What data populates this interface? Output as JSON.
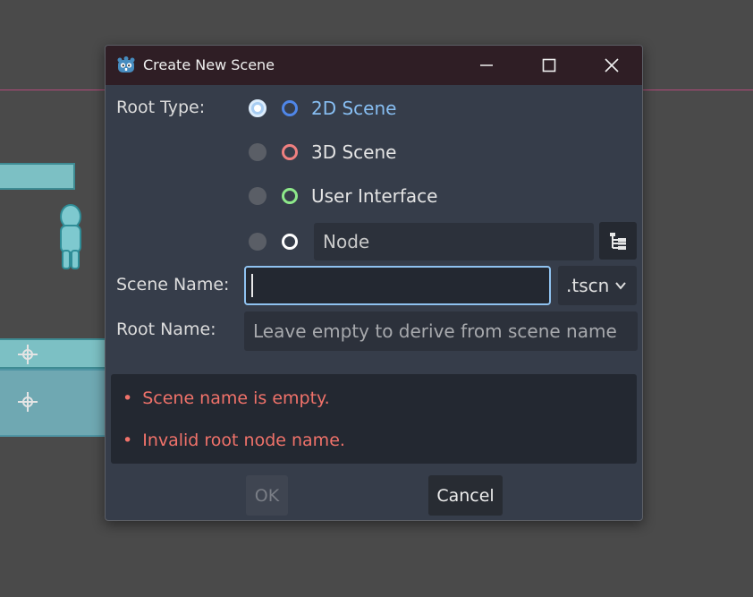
{
  "dialog": {
    "title": "Create New Scene",
    "icon": "godot-logo-icon",
    "window_controls": [
      "minimize-icon",
      "maximize-icon",
      "close-icon"
    ]
  },
  "root_type": {
    "label": "Root Type:",
    "options": [
      {
        "label": "2D Scene",
        "selected": true,
        "icon_color": "#4f86e8"
      },
      {
        "label": "3D Scene",
        "selected": false,
        "icon_color": "#f08080"
      },
      {
        "label": "User Interface",
        "selected": false,
        "icon_color": "#8ee98a"
      },
      {
        "label": "Node",
        "selected": false,
        "icon_color": "#ffffff",
        "is_field": true
      }
    ]
  },
  "scene_name": {
    "label": "Scene Name:",
    "value": "",
    "extension": ".tscn"
  },
  "root_name": {
    "label": "Root Name:",
    "placeholder": "Leave empty to derive from scene name"
  },
  "errors": [
    "Scene name is empty.",
    "Invalid root node name."
  ],
  "buttons": {
    "ok": "OK",
    "cancel": "Cancel"
  },
  "colors": {
    "accent": "#87bef2",
    "error": "#f0726a",
    "titlebar": "#2f1e25"
  }
}
